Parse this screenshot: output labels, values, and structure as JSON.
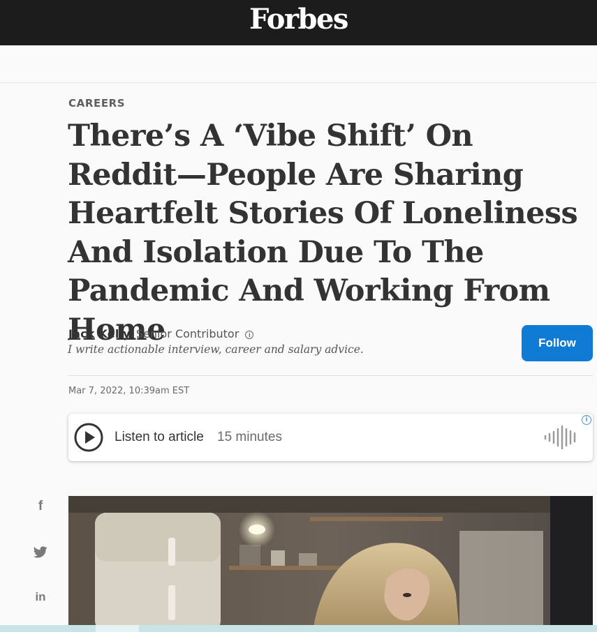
{
  "header": {
    "logo_text": "Forbes"
  },
  "article": {
    "channel": "CAREERS",
    "headline": "There’s A ‘Vibe Shift’ On Reddit—People Are Sharing Heartfelt Stories Of Loneliness And Isolation Due To The Pandemic And Working From Home",
    "author": {
      "name": "Jack Kelly",
      "role": "Senior Contributor",
      "bio": "I write actionable interview, career and salary advice.",
      "follow_label": "Follow"
    },
    "timestamp": "Mar 7, 2022, 10:39am EST"
  },
  "audio": {
    "label": "Listen to article",
    "duration": "15 minutes"
  },
  "social": [
    {
      "name": "facebook",
      "glyph": "f"
    },
    {
      "name": "twitter",
      "glyph": ""
    },
    {
      "name": "linkedin",
      "glyph": "in"
    }
  ],
  "colors": {
    "topbar": "#1c1c1c",
    "follow_button": "#0f7bd4",
    "ad_info": "#4a90d9"
  }
}
